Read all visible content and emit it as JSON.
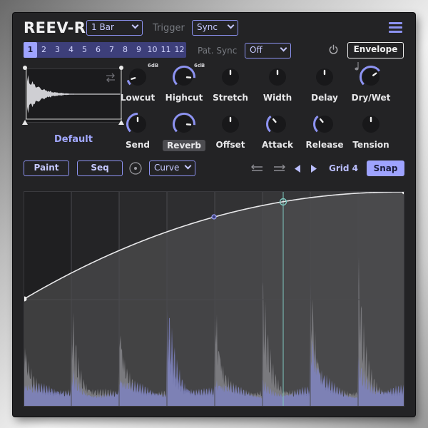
{
  "header": {
    "title": "REEV-R",
    "length_value": "1 Bar",
    "trigger_label": "Trigger",
    "trigger_value": "Sync",
    "menu_icon": "hamburger-icon"
  },
  "patterns": {
    "items": [
      "1",
      "2",
      "3",
      "4",
      "5",
      "6",
      "7",
      "8",
      "9",
      "10",
      "11",
      "12"
    ],
    "active_index": 0,
    "pat_sync_label": "Pat. Sync",
    "pat_sync_value": "Off"
  },
  "power_icon": "power-icon",
  "envelope_button": "Envelope",
  "sample": {
    "name": "Default",
    "swap_icon": "swap-arrows-icon"
  },
  "knobs_row1": [
    {
      "label": "Lowcut",
      "value": 0.1,
      "badge": "6dB"
    },
    {
      "label": "Highcut",
      "value": 0.85,
      "badge": "6dB"
    },
    {
      "label": "Stretch",
      "value": 0.5
    },
    {
      "label": "Width",
      "value": 0.5
    },
    {
      "label": "Delay",
      "value": 0.5
    },
    {
      "label": "Dry/Wet",
      "value": 0.7
    }
  ],
  "knobs_row2": [
    {
      "label": "Send",
      "value": 0.5
    },
    {
      "label": "Reverb",
      "value": 0.85,
      "highlight": true
    },
    {
      "label": "Offset",
      "value": 0.5
    },
    {
      "label": "Attack",
      "value": 0.35
    },
    {
      "label": "Release",
      "value": 0.35
    },
    {
      "label": "Tension",
      "value": 0.5
    }
  ],
  "note_icon": "note-icon",
  "toolbar": {
    "paint": "Paint",
    "seq": "Seq",
    "curve_value": "Curve",
    "grid": "Grid 4",
    "snap": "Snap"
  },
  "colors": {
    "accent": "#8d93f2",
    "accent_fill": "#9ea3ff",
    "panel": "#232325"
  }
}
